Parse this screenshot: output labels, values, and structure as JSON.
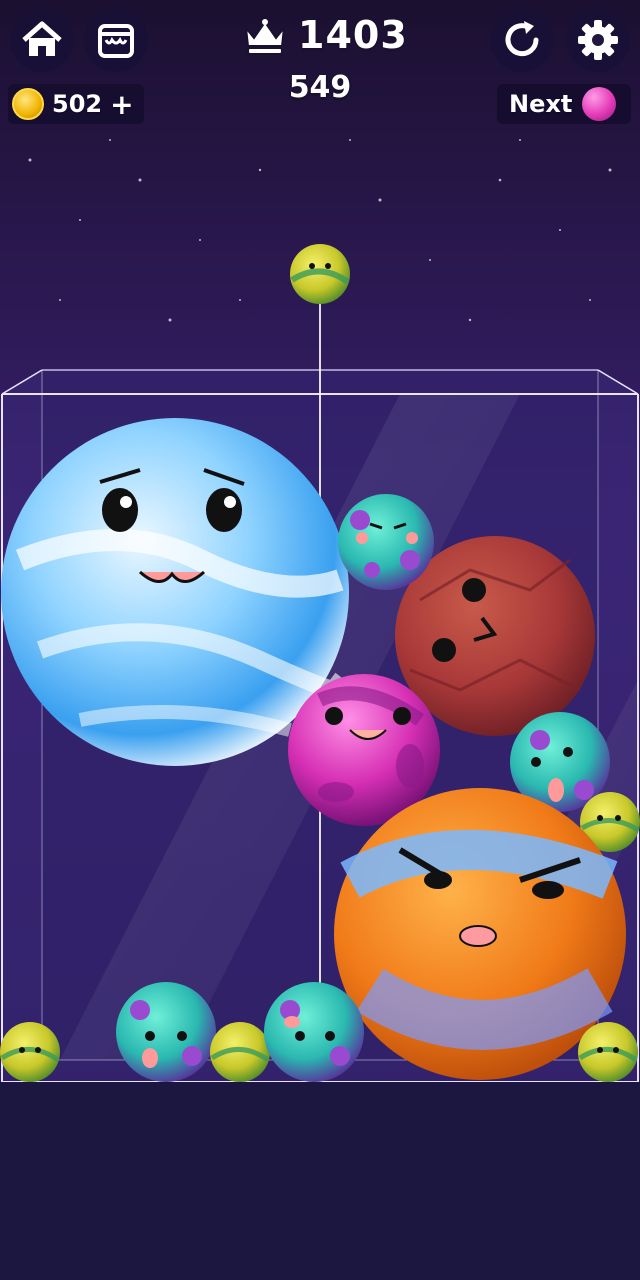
{
  "hud": {
    "best_score": "1403",
    "score": "549",
    "coins": "502",
    "add_coins_label": "+",
    "next_label": "Next",
    "next_planet": "pink-planet"
  },
  "icons": {
    "home": "home-icon",
    "shop": "shop-icon",
    "crown": "crown-icon",
    "restart": "restart-icon",
    "settings": "gear-icon",
    "coin": "coin-icon"
  },
  "planets_in_play": [
    {
      "kind": "yellow-green",
      "state": "held"
    },
    {
      "kind": "blue-white",
      "face": "cute"
    },
    {
      "kind": "teal-purple",
      "face": "smug"
    },
    {
      "kind": "red-brown",
      "face": "dot-eyes"
    },
    {
      "kind": "magenta",
      "face": "happy"
    },
    {
      "kind": "teal-purple",
      "face": "cute"
    },
    {
      "kind": "yellow-green",
      "face": "small"
    },
    {
      "kind": "orange-blue",
      "face": "angry"
    },
    {
      "kind": "yellow-green",
      "face": "small"
    },
    {
      "kind": "teal-purple",
      "face": "cute"
    },
    {
      "kind": "yellow-green",
      "face": "small"
    },
    {
      "kind": "teal-purple",
      "face": "cute"
    },
    {
      "kind": "yellow-green",
      "face": "small"
    }
  ],
  "colors": {
    "sky_top": "#1b1030",
    "sky_bottom": "#3a2070",
    "floor": "#1c1740",
    "glass_edge": "#e8e4ff"
  }
}
